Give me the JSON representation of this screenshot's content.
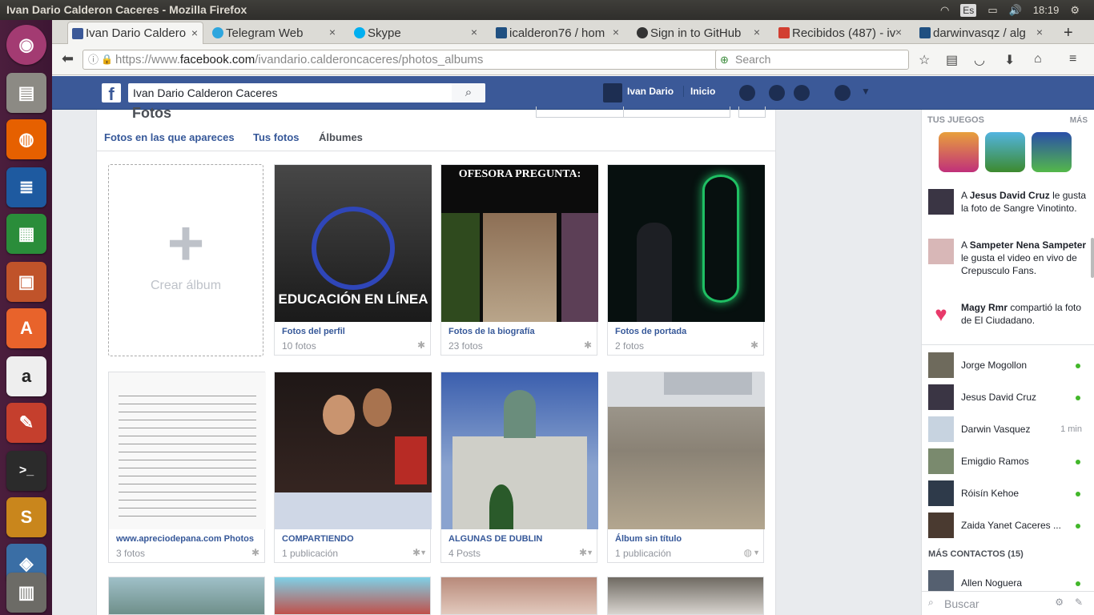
{
  "window_title": "Ivan Dario Calderon Caceres - Mozilla Firefox",
  "system": {
    "lang": "Es",
    "time": "18:19"
  },
  "tabs": [
    {
      "label": "Ivan Dario Caldero",
      "active": true,
      "color": "#3b5998"
    },
    {
      "label": "Telegram Web",
      "color": "#2ea6de"
    },
    {
      "label": "Skype",
      "color": "#00aff0"
    },
    {
      "label": "icalderon76 / hom",
      "color": "#205081"
    },
    {
      "label": "Sign in to GitHub",
      "color": "#333333"
    },
    {
      "label": "Recibidos (487) - iv",
      "color": "#d23f31"
    },
    {
      "label": "darwinvasqz / alg",
      "color": "#205081"
    }
  ],
  "url": {
    "prefix": "https://www.",
    "domain": "facebook.com",
    "path": "/ivandario.calderoncaceres/photos_albums"
  },
  "search_placeholder": "Search",
  "fb": {
    "search_value": "Ivan Dario Calderon Caceres",
    "user": "Ivan Dario",
    "home": "Inicio",
    "page_header": "Fotos"
  },
  "subtabs": [
    "Fotos en las que apareces",
    "Tus fotos",
    "Álbumes"
  ],
  "create_album": "Crear álbum",
  "albums": [
    {
      "title": "Fotos del perfil",
      "sub": "10 fotos",
      "art": "EDUCACIÓN EN LÍNEA"
    },
    {
      "title": "Fotos de la biografía",
      "sub": "23 fotos",
      "art": "OFESORA PREGUNTA:"
    },
    {
      "title": "Fotos de portada",
      "sub": "2 fotos"
    },
    {
      "title": "www.apreciodepana.com Photos",
      "sub": "3 fotos"
    },
    {
      "title": "COMPARTIENDO",
      "sub": "1 publicación"
    },
    {
      "title": "ALGUNAS DE DUBLIN",
      "sub": "4 Posts"
    },
    {
      "title": "Álbum sin título",
      "sub": "1 publicación"
    }
  ],
  "sidebar": {
    "games_title": "TUS JUEGOS",
    "games_more": "MÁS",
    "ticker": [
      {
        "pre": "A ",
        "name": "Jesus David Cruz",
        "post": " le gusta la foto de Sangre Vinotinto."
      },
      {
        "pre": "A ",
        "name": "Sampeter Nena Sampeter",
        "post": " le gusta el video en vivo de Crepusculo Fans."
      },
      {
        "pre": "",
        "name": "Magy Rmr",
        "post": " compartió la foto de El Ciudadano."
      }
    ],
    "contacts": [
      {
        "name": "Jorge Mogollon",
        "status": "online"
      },
      {
        "name": "Jesus David Cruz",
        "status": "online"
      },
      {
        "name": "Darwin Vasquez",
        "status": "1 min"
      },
      {
        "name": "Emigdio Ramos",
        "status": "online"
      },
      {
        "name": "Róisín Kehoe",
        "status": "online"
      },
      {
        "name": "Zaida Yanet Caceres ...",
        "status": "online"
      }
    ],
    "more_contacts": "MÁS CONTACTOS (15)",
    "more_list": [
      {
        "name": "Allen Noguera",
        "status": "online"
      }
    ],
    "chat_search": "Buscar"
  }
}
